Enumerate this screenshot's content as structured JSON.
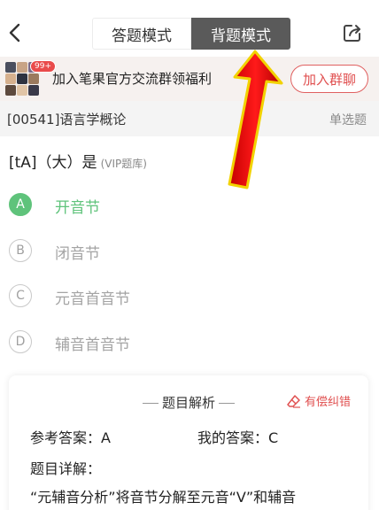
{
  "header": {
    "mode_tabs": [
      "答题模式",
      "背题模式"
    ],
    "active_tab_index": 1,
    "back_icon": "chevron-left-icon",
    "share_icon": "share-icon"
  },
  "banner": {
    "badge": "99+",
    "text": "加入笔果官方交流群领福利",
    "join_button": "加入群聊"
  },
  "subject": {
    "name": "[00541]语言学概论",
    "type": "单选题"
  },
  "question": {
    "stem": "[tA]（大）是",
    "tag": "(VIP题库)"
  },
  "options": [
    {
      "letter": "A",
      "text": "开音节",
      "correct": true
    },
    {
      "letter": "B",
      "text": "闭音节",
      "correct": false
    },
    {
      "letter": "C",
      "text": "元音首音节",
      "correct": false
    },
    {
      "letter": "D",
      "text": "辅音首音节",
      "correct": false
    }
  ],
  "analysis": {
    "title": "题目解析",
    "report_link": "有偿纠错",
    "reference_answer": "参考答案：A",
    "my_answer": "我的答案：C",
    "detail_label": "题目详解：",
    "detail_text": "“元辅音分析”将音节分解至元音“V”和辅音"
  },
  "colors": {
    "correct": "#5fc37b",
    "accent_red": "#e05050",
    "active_tab": "#5a5a5a"
  }
}
